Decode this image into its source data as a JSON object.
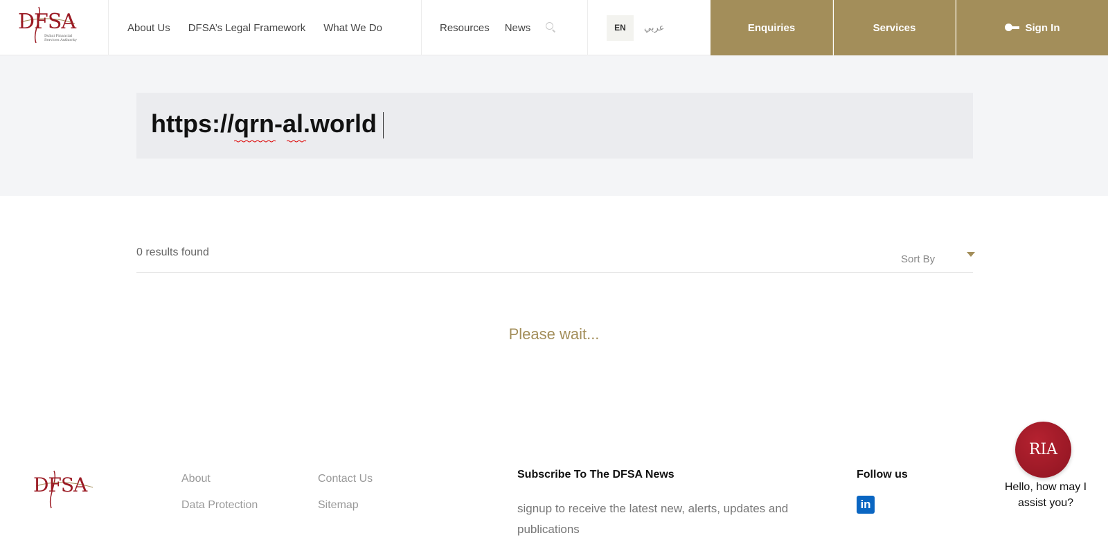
{
  "header": {
    "logo_text": "DFSA",
    "logo_subtext": "Dubai Financial Services Authority",
    "nav_primary": [
      "About Us",
      "DFSA’s Legal Framework",
      "What We Do"
    ],
    "nav_secondary": [
      "Resources",
      "News"
    ],
    "search_icon": "search-icon",
    "lang_en": "EN",
    "lang_ar": "عربي",
    "enquiries": "Enquiries",
    "services": "Services",
    "sign_in": "Sign In",
    "key_icon": "key-icon",
    "accent_color": "#a38e5a",
    "brand_color": "#9b1b24"
  },
  "search": {
    "value": "https://qrn-al.world"
  },
  "results": {
    "count_text": "0 results found",
    "sort_label": "Sort By",
    "status": "Please wait..."
  },
  "footer": {
    "logo_text": "DFSA",
    "links_col1": [
      "About",
      "Data Protection"
    ],
    "links_col2": [
      "Contact Us",
      "Sitemap"
    ],
    "subscribe_heading": "Subscribe To The DFSA News",
    "subscribe_text": "signup to receive the latest new, alerts, updates and publications",
    "follow_heading": "Follow us",
    "linkedin_label": "in"
  },
  "chat": {
    "badge": "RIA",
    "greeting": "Hello, how may I assist you?"
  }
}
